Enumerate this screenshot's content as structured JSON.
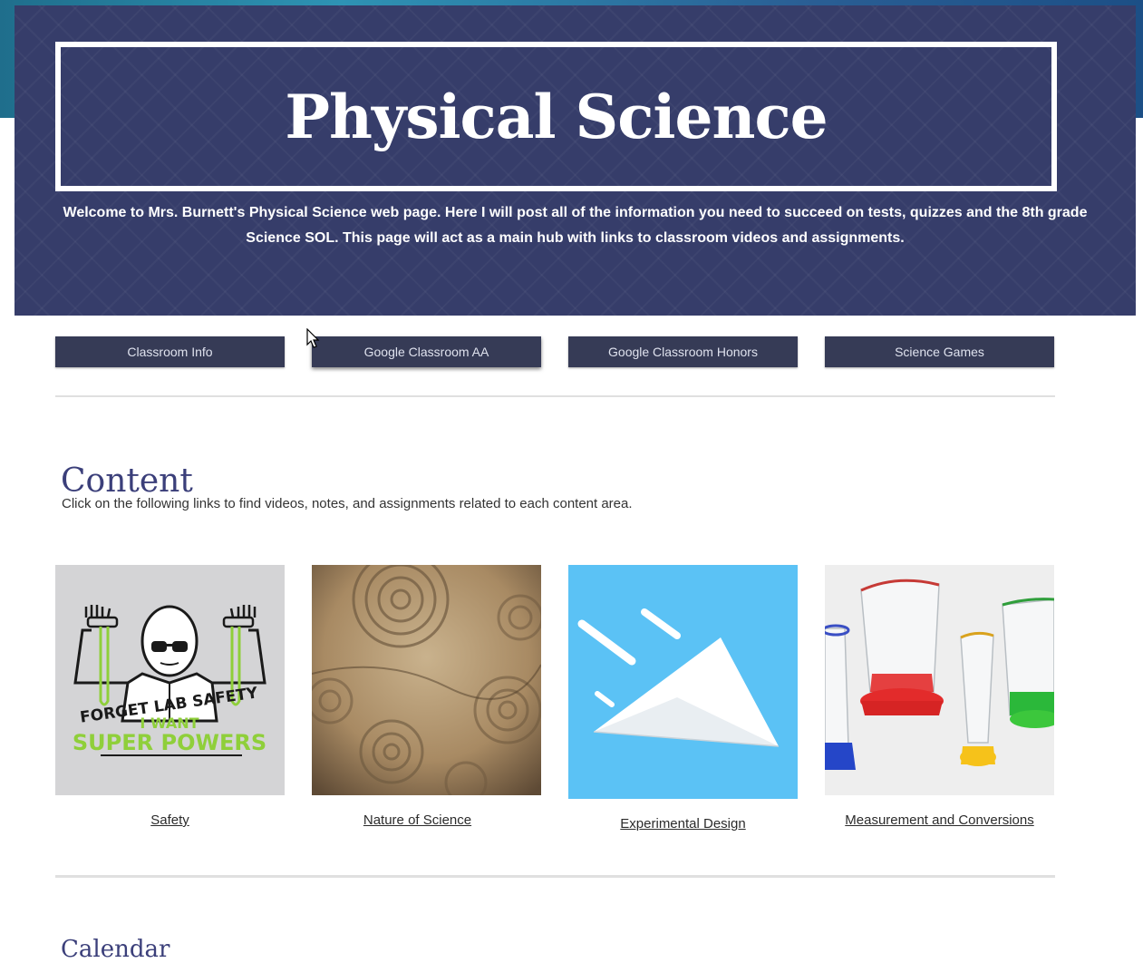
{
  "header": {
    "title": "Physical Science",
    "welcome": "Welcome to Mrs. Burnett's Physical Science web page.   Here I will post all of the information you need to succeed on tests, quizzes and the 8th grade Science SOL. This page will act as a main hub with links to classroom videos and assignments."
  },
  "nav": {
    "items": [
      {
        "label": "Classroom Info"
      },
      {
        "label": "Google Classroom AA"
      },
      {
        "label": "Google Classroom Honors"
      },
      {
        "label": "Science Games"
      }
    ]
  },
  "content": {
    "title": "Content",
    "intro": "Click on the following links to find videos, notes, and assignments related to each content area.",
    "cards": [
      {
        "label": "Safety",
        "image": "lab-safety-illustration",
        "image_text": [
          "FORGET LAB SAFETY",
          "I WANT",
          "SUPER POWERS"
        ]
      },
      {
        "label": "Nature of Science",
        "image": "ammonite-fossils-photo"
      },
      {
        "label": "Experimental Design",
        "image": "paper-airplane-illustration"
      },
      {
        "label": "Measurement and Conversions",
        "image": "measuring-cups-photo"
      }
    ]
  },
  "calendar": {
    "title": "Calendar"
  },
  "colors": {
    "banner": "#363d6a",
    "nav_button": "#363b56",
    "heading": "#3b3f7a",
    "lime": "#8fcf3a",
    "sky": "#5bc2f5"
  }
}
